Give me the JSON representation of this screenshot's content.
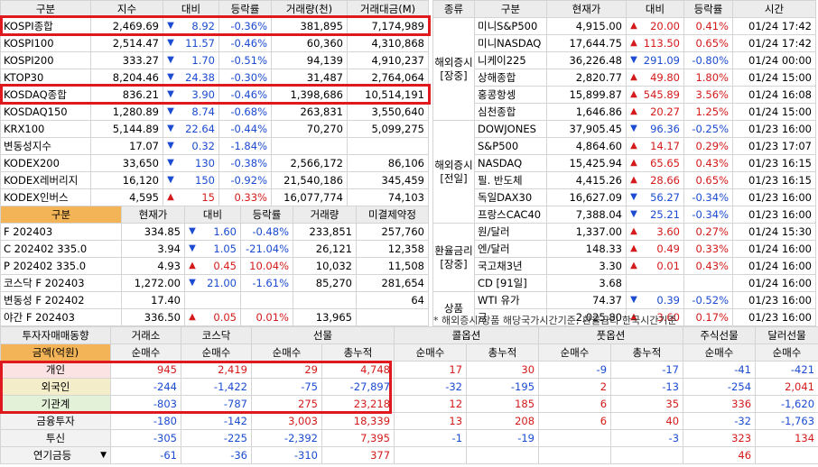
{
  "index_table": {
    "headers": [
      "구분",
      "지수",
      "대비",
      "등락률",
      "거래량(천)",
      "거래대금(M)"
    ],
    "rows": [
      {
        "name": "KOSPI종합",
        "value": "2,469.69",
        "dir": "down",
        "change": "8.92",
        "rate": "-0.36%",
        "volume": "381,895",
        "amount": "7,174,989"
      },
      {
        "name": "KOSPI100",
        "value": "2,514.47",
        "dir": "down",
        "change": "11.57",
        "rate": "-0.46%",
        "volume": "60,360",
        "amount": "4,310,868"
      },
      {
        "name": "KOSPI200",
        "value": "333.27",
        "dir": "down",
        "change": "1.70",
        "rate": "-0.51%",
        "volume": "94,139",
        "amount": "4,910,237"
      },
      {
        "name": "KTOP30",
        "value": "8,204.46",
        "dir": "down",
        "change": "24.38",
        "rate": "-0.30%",
        "volume": "31,487",
        "amount": "2,764,064"
      },
      {
        "name": "KOSDAQ종합",
        "value": "836.21",
        "dir": "down",
        "change": "3.90",
        "rate": "-0.46%",
        "volume": "1,398,686",
        "amount": "10,514,191"
      },
      {
        "name": "KOSDAQ150",
        "value": "1,280.89",
        "dir": "down",
        "change": "8.74",
        "rate": "-0.68%",
        "volume": "263,831",
        "amount": "3,550,640"
      },
      {
        "name": "KRX100",
        "value": "5,144.89",
        "dir": "down",
        "change": "22.64",
        "rate": "-0.44%",
        "volume": "70,270",
        "amount": "5,099,275"
      },
      {
        "name": "변동성지수",
        "value": "17.07",
        "dir": "down",
        "change": "0.32",
        "rate": "-1.84%",
        "volume": "",
        "amount": ""
      },
      {
        "name": "KODEX200",
        "value": "33,650",
        "dir": "down",
        "change": "130",
        "rate": "-0.38%",
        "volume": "2,566,172",
        "amount": "86,106"
      },
      {
        "name": "KODEX레버리지",
        "value": "16,120",
        "dir": "down",
        "change": "150",
        "rate": "-0.92%",
        "volume": "21,540,186",
        "amount": "345,459"
      },
      {
        "name": "KODEX인버스",
        "value": "4,595",
        "dir": "up",
        "change": "15",
        "rate": "0.33%",
        "volume": "16,077,774",
        "amount": "74,103"
      }
    ]
  },
  "futures_table": {
    "headers": [
      "구분",
      "현재가",
      "대비",
      "등락률",
      "거래량",
      "미결제약정"
    ],
    "rows": [
      {
        "name": "F 202403",
        "value": "334.85",
        "dir": "down",
        "change": "1.60",
        "rate": "-0.48%",
        "volume": "233,851",
        "oi": "257,760"
      },
      {
        "name": "C 202402 335.0",
        "value": "3.94",
        "dir": "down",
        "change": "1.05",
        "rate": "-21.04%",
        "volume": "26,121",
        "oi": "12,358"
      },
      {
        "name": "P 202402 335.0",
        "value": "4.93",
        "dir": "up",
        "change": "0.45",
        "rate": "10.04%",
        "volume": "10,032",
        "oi": "11,508"
      },
      {
        "name": "코스닥 F 202403",
        "value": "1,272.00",
        "dir": "down",
        "change": "21.00",
        "rate": "-1.61%",
        "volume": "85,270",
        "oi": "281,654"
      },
      {
        "name": "변동성 F 202402",
        "value": "17.40",
        "dir": "",
        "change": "",
        "rate": "",
        "volume": "",
        "oi": "64"
      },
      {
        "name": "야간 F 202403",
        "value": "336.50",
        "dir": "up",
        "change": "0.05",
        "rate": "0.01%",
        "volume": "13,965",
        "oi": ""
      }
    ]
  },
  "global_table": {
    "headers": [
      "종류",
      "구분",
      "현재가",
      "대비",
      "등락률",
      "시간"
    ],
    "groups": [
      {
        "label": "해외증시[장중]",
        "rows": [
          {
            "name": "미니S&P500",
            "value": "4,915.00",
            "dir": "up",
            "change": "20.00",
            "rate": "0.41%",
            "time": "01/24 17:42"
          },
          {
            "name": "미니NASDAQ",
            "value": "17,644.75",
            "dir": "up",
            "change": "113.50",
            "rate": "0.65%",
            "time": "01/24 17:42"
          },
          {
            "name": "니케이225",
            "value": "36,226.48",
            "dir": "down",
            "change": "291.09",
            "rate": "-0.80%",
            "time": "01/24 00:00"
          },
          {
            "name": "상해종합",
            "value": "2,820.77",
            "dir": "up",
            "change": "49.80",
            "rate": "1.80%",
            "time": "01/24 15:00"
          },
          {
            "name": "홍콩항셍",
            "value": "15,899.87",
            "dir": "up",
            "change": "545.89",
            "rate": "3.56%",
            "time": "01/24 16:08"
          },
          {
            "name": "심천종합",
            "value": "1,646.86",
            "dir": "up",
            "change": "20.27",
            "rate": "1.25%",
            "time": "01/24 15:00"
          }
        ]
      },
      {
        "label": "해외증시[전일]",
        "rows": [
          {
            "name": "DOWJONES",
            "value": "37,905.45",
            "dir": "down",
            "change": "96.36",
            "rate": "-0.25%",
            "time": "01/23 16:00"
          },
          {
            "name": "S&P500",
            "value": "4,864.60",
            "dir": "up",
            "change": "14.17",
            "rate": "0.29%",
            "time": "01/23 17:07"
          },
          {
            "name": "NASDAQ",
            "value": "15,425.94",
            "dir": "up",
            "change": "65.65",
            "rate": "0.43%",
            "time": "01/23 16:15"
          },
          {
            "name": "필. 반도체",
            "value": "4,415.26",
            "dir": "up",
            "change": "28.66",
            "rate": "0.65%",
            "time": "01/23 16:15"
          },
          {
            "name": "독일DAX30",
            "value": "16,627.09",
            "dir": "down",
            "change": "56.27",
            "rate": "-0.34%",
            "time": "01/23 16:00"
          },
          {
            "name": "프랑스CAC40",
            "value": "7,388.04",
            "dir": "down",
            "change": "25.21",
            "rate": "-0.34%",
            "time": "01/23 16:00"
          }
        ]
      },
      {
        "label": "환율금리[장중]",
        "rows": [
          {
            "name": "원/달러",
            "value": "1,337.00",
            "dir": "up",
            "change": "3.60",
            "rate": "0.27%",
            "time": "01/24 15:30"
          },
          {
            "name": "엔/달러",
            "value": "148.33",
            "dir": "up",
            "change": "0.49",
            "rate": "0.33%",
            "time": "01/24 16:00"
          },
          {
            "name": "국고채3년",
            "value": "3.30",
            "dir": "up",
            "change": "0.01",
            "rate": "0.43%",
            "time": "01/24 16:00"
          },
          {
            "name": "CD [91일]",
            "value": "3.68",
            "dir": "",
            "change": "",
            "rate": "",
            "time": "01/24 16:00"
          }
        ]
      },
      {
        "label": "상품",
        "rows": [
          {
            "name": "WTI 유가",
            "value": "74.37",
            "dir": "down",
            "change": "0.39",
            "rate": "-0.52%",
            "time": "01/23 16:00"
          },
          {
            "name": "금",
            "value": "2,025.80",
            "dir": "up",
            "change": "3.60",
            "rate": "0.17%",
            "time": "01/23 16:00"
          }
        ]
      }
    ],
    "note": "* 해외증시/상품 해당국가시간기준, 환율금리 한국시간기준"
  },
  "investor_table": {
    "top_left": "투자자매매동향",
    "sub_left": "금액(억원)",
    "groups": [
      "거래소",
      "코스닥",
      "선물",
      "콜옵션",
      "풋옵션",
      "주식선물",
      "달러선물"
    ],
    "subheaders": [
      "순매수",
      "순매수",
      "순매수",
      "총누적",
      "순매수",
      "총누적",
      "순매수",
      "총누적",
      "순매수",
      "순매수"
    ],
    "rows": [
      {
        "name": "개인",
        "tone": "p",
        "values": [
          "945",
          "2,419",
          "29",
          "4,748",
          "17",
          "30",
          "-9",
          "-17",
          "-41",
          "-421"
        ]
      },
      {
        "name": "외국인",
        "tone": "y",
        "values": [
          "-244",
          "-1,422",
          "-75",
          "-27,897",
          "-32",
          "-195",
          "2",
          "-13",
          "-254",
          "2,041"
        ]
      },
      {
        "name": "기관계",
        "tone": "g",
        "values": [
          "-803",
          "-787",
          "275",
          "23,218",
          "12",
          "185",
          "6",
          "35",
          "336",
          "-1,620"
        ]
      },
      {
        "name": "금융투자",
        "tone": "w",
        "values": [
          "-180",
          "-142",
          "3,003",
          "18,339",
          "13",
          "208",
          "6",
          "40",
          "-32",
          "-1,763"
        ]
      },
      {
        "name": "투신",
        "tone": "w",
        "values": [
          "-305",
          "-225",
          "-2,392",
          "7,395",
          "-1",
          "-19",
          "",
          "-3",
          "323",
          "134"
        ]
      },
      {
        "name": "연기금등",
        "tone": "w",
        "values": [
          "-61",
          "-36",
          "-310",
          "377",
          "",
          "",
          "",
          "",
          "46",
          ""
        ]
      }
    ]
  },
  "colors": {
    "up": "#d41a1a",
    "down": "#1b4bd0",
    "highlight": "#e0191f",
    "header": "#ececec",
    "orange": "#f3b457"
  }
}
